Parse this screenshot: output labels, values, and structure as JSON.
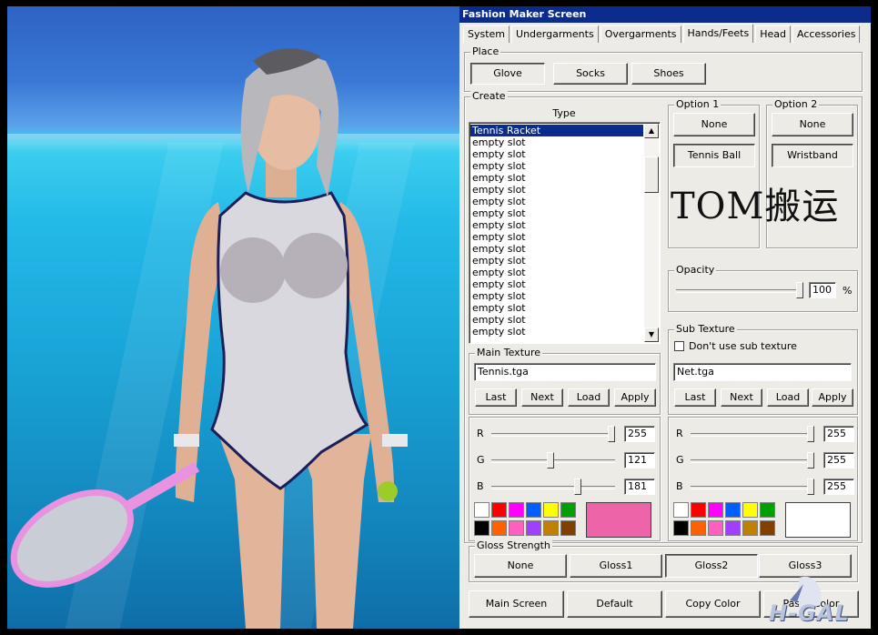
{
  "window": {
    "title": "Fashion Maker Screen"
  },
  "tabs": [
    {
      "label": "System",
      "active": false
    },
    {
      "label": "Undergarments",
      "active": false
    },
    {
      "label": "Overgarments",
      "active": false
    },
    {
      "label": "Hands/Feets",
      "active": true
    },
    {
      "label": "Head",
      "active": false
    },
    {
      "label": "Accessories",
      "active": false
    }
  ],
  "place": {
    "label": "Place",
    "buttons": [
      {
        "label": "Glove",
        "pressed": true
      },
      {
        "label": "Socks",
        "pressed": false
      },
      {
        "label": "Shoes",
        "pressed": false
      }
    ]
  },
  "create": {
    "label": "Create",
    "type_header": "Type",
    "items": [
      "Tennis Racket",
      "empty slot",
      "empty slot",
      "empty slot",
      "empty slot",
      "empty slot",
      "empty slot",
      "empty slot",
      "empty slot",
      "empty slot",
      "empty slot",
      "empty slot",
      "empty slot",
      "empty slot",
      "empty slot",
      "empty slot",
      "empty slot",
      "empty slot"
    ],
    "selected_index": 0
  },
  "option1": {
    "label": "Option 1",
    "button": "None",
    "value": "Tennis Ball"
  },
  "option2": {
    "label": "Option 2",
    "button": "None",
    "value": "Wristband"
  },
  "opacity": {
    "label": "Opacity",
    "value": "100",
    "unit": "%",
    "level": 1.0
  },
  "main_texture": {
    "label": "Main Texture",
    "file": "Tennis.tga",
    "buttons": {
      "last": "Last",
      "next": "Next",
      "load": "Load",
      "apply": "Apply"
    },
    "r": {
      "label": "R",
      "value": "255",
      "level": 1.0
    },
    "g": {
      "label": "G",
      "value": "121",
      "level": 0.475
    },
    "b": {
      "label": "B",
      "value": "181",
      "level": 0.71
    },
    "preview_color": "#ee64a8"
  },
  "sub_texture": {
    "label": "Sub Texture",
    "checkbox_label": "Don't use sub texture",
    "file": "Net.tga",
    "buttons": {
      "last": "Last",
      "next": "Next",
      "load": "Load",
      "apply": "Apply"
    },
    "r": {
      "label": "R",
      "value": "255",
      "level": 1.0
    },
    "g": {
      "label": "G",
      "value": "255",
      "level": 1.0
    },
    "b": {
      "label": "B",
      "value": "255",
      "level": 1.0
    },
    "preview_color": "#ffffff"
  },
  "palette": [
    "#ffffff",
    "#ff0000",
    "#ff00ff",
    "#0060ff",
    "#ffff00",
    "#00a000",
    "#000000",
    "#ff6000",
    "#ff60c0",
    "#a040ff",
    "#c08000",
    "#804000"
  ],
  "gloss": {
    "label": "Gloss Strength",
    "buttons": [
      {
        "label": "None",
        "pressed": false
      },
      {
        "label": "Gloss1",
        "pressed": false
      },
      {
        "label": "Gloss2",
        "pressed": true
      },
      {
        "label": "Gloss3",
        "pressed": false
      }
    ]
  },
  "footer": {
    "main_screen": "Main Screen",
    "default": "Default",
    "copy_color": "Copy Color",
    "paste_color": "Paste Color"
  },
  "watermark": "TOM搬运",
  "logo_text": "H-GAL"
}
